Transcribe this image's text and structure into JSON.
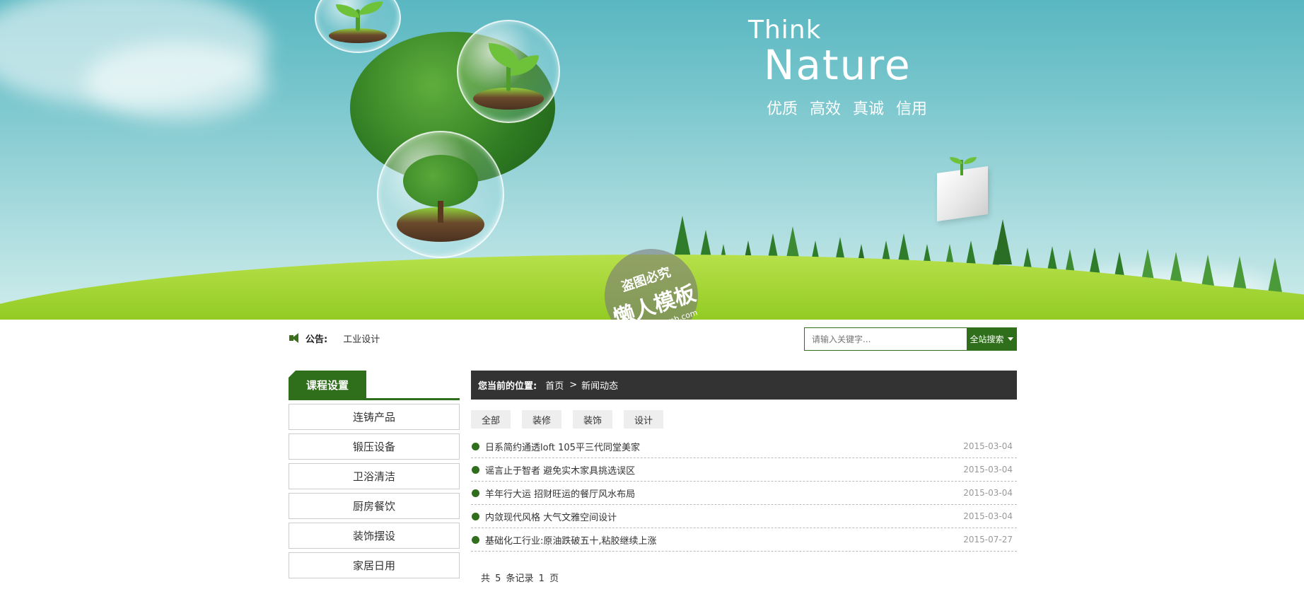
{
  "banner": {
    "slogan_think": "Think",
    "slogan_nature": "Nature",
    "slogan_values": "优质  高效  真诚 信用",
    "watermark_line1": "盗图必究",
    "watermark_line2": "懒人模板",
    "watermark_line3": "www.lanrenmb.com"
  },
  "notice": {
    "label": "公告:",
    "text": "工业设计"
  },
  "search": {
    "placeholder": "请输入关键字...",
    "button_label": "全站搜索"
  },
  "sidebar": {
    "title": "课程设置",
    "items": [
      "连铸产品",
      "锻压设备",
      "卫浴清洁",
      "厨房餐饮",
      "装饰摆设",
      "家居日用"
    ]
  },
  "breadcrumb": {
    "label": "您当前的位置:",
    "home": "首页",
    "separator": ">",
    "current": "新闻动态"
  },
  "filters": [
    "全部",
    "装修",
    "装饰",
    "设计"
  ],
  "news": [
    {
      "title": "日系简约通透loft 105平三代同堂美家",
      "date": "2015-03-04"
    },
    {
      "title": "谣言止于智者 避免实木家具挑选误区",
      "date": "2015-03-04"
    },
    {
      "title": "羊年行大运 招财旺运的餐厅风水布局",
      "date": "2015-03-04"
    },
    {
      "title": "内敛现代风格 大气文雅空间设计",
      "date": "2015-03-04"
    },
    {
      "title": "基础化工行业:原油跌破五十,粘胶继续上涨",
      "date": "2015-07-27"
    }
  ],
  "pager": "共 5 条记录 1 页",
  "colors": {
    "brand_green": "#2f6e1a",
    "breadcrumb_bg": "#333333",
    "sky": "#59b7c1"
  }
}
